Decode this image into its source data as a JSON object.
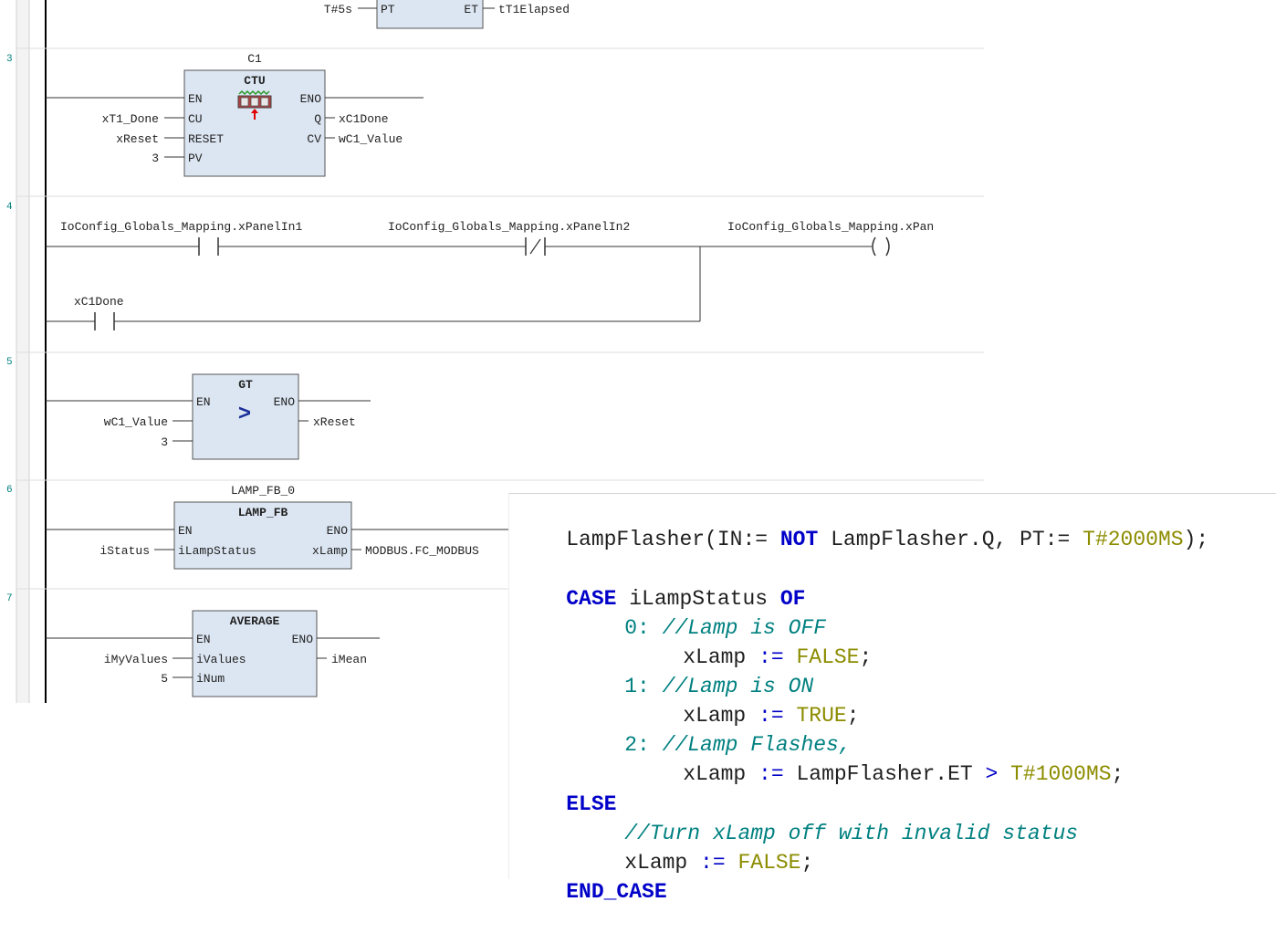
{
  "networks": {
    "n2": {
      "pt_input": "T#5s",
      "pin_pt": "PT",
      "pin_et": "ET",
      "et_output": "tT1Elapsed"
    },
    "n3": {
      "number": "3",
      "instance": "C1",
      "block_type": "CTU",
      "pin_en": "EN",
      "pin_eno": "ENO",
      "pin_cu": "CU",
      "pin_reset": "RESET",
      "pin_pv": "PV",
      "pin_q": "Q",
      "pin_cv": "CV",
      "input_cu": "xT1_Done",
      "input_reset": "xReset",
      "input_pv": "3",
      "output_q": "xC1Done",
      "output_cv": "wC1_Value"
    },
    "n4": {
      "number": "4",
      "contact1": "IoConfig_Globals_Mapping.xPanelIn1",
      "contact2": "IoConfig_Globals_Mapping.xPanelIn2",
      "coil": "IoConfig_Globals_Mapping.xPan",
      "parallel_contact": "xC1Done"
    },
    "n5": {
      "number": "5",
      "block_type": "GT",
      "symbol": ">",
      "pin_en": "EN",
      "pin_eno": "ENO",
      "input1": "wC1_Value",
      "input2": "3",
      "output": "xReset"
    },
    "n6": {
      "number": "6",
      "instance": "LAMP_FB_0",
      "block_type": "LAMP_FB",
      "pin_en": "EN",
      "pin_eno": "ENO",
      "pin_in": "iLampStatus",
      "pin_out": "xLamp",
      "input": "iStatus",
      "output": "MODBUS.FC_MODBUS"
    },
    "n7": {
      "number": "7",
      "block_type": "AVERAGE",
      "pin_en": "EN",
      "pin_eno": "ENO",
      "pin_values": "iValues",
      "pin_num": "iNum",
      "input_values": "iMyValues",
      "input_num": "5",
      "output": "iMean"
    }
  },
  "code": {
    "l1": {
      "a": "LampFlasher(IN:= ",
      "b": "NOT",
      "c": " LampFlasher.Q, PT:= ",
      "d": "T#2000MS",
      "e": ");"
    },
    "l2": {
      "a": "CASE",
      "b": " iLampStatus ",
      "c": "OF"
    },
    "l3": {
      "a": "0:",
      "b": " //Lamp is OFF"
    },
    "l4": {
      "a": "xLamp ",
      "b": ":=",
      "c": " ",
      "d": "FALSE",
      "e": ";"
    },
    "l5": {
      "a": "1:",
      "b": " //Lamp is ON"
    },
    "l6": {
      "a": "xLamp ",
      "b": ":=",
      "c": " ",
      "d": "TRUE",
      "e": ";"
    },
    "l7": {
      "a": "2:",
      "b": " //Lamp Flashes,"
    },
    "l8": {
      "a": "xLamp ",
      "b": ":=",
      "c": " LampFlasher.ET ",
      "d": ">",
      "e": " ",
      "f": "T#1000MS",
      "g": ";"
    },
    "l9": {
      "a": "ELSE"
    },
    "l10": {
      "a": "//Turn xLamp off with invalid status"
    },
    "l11": {
      "a": "xLamp ",
      "b": ":=",
      "c": " ",
      "d": "FALSE",
      "e": ";"
    },
    "l12": {
      "a": "END_CASE"
    }
  },
  "colors": {
    "block_fill": "#dce6f2",
    "keyword": "#0000c8",
    "literal": "#8c8c00",
    "comment": "#008080",
    "network_number": "#008080"
  }
}
